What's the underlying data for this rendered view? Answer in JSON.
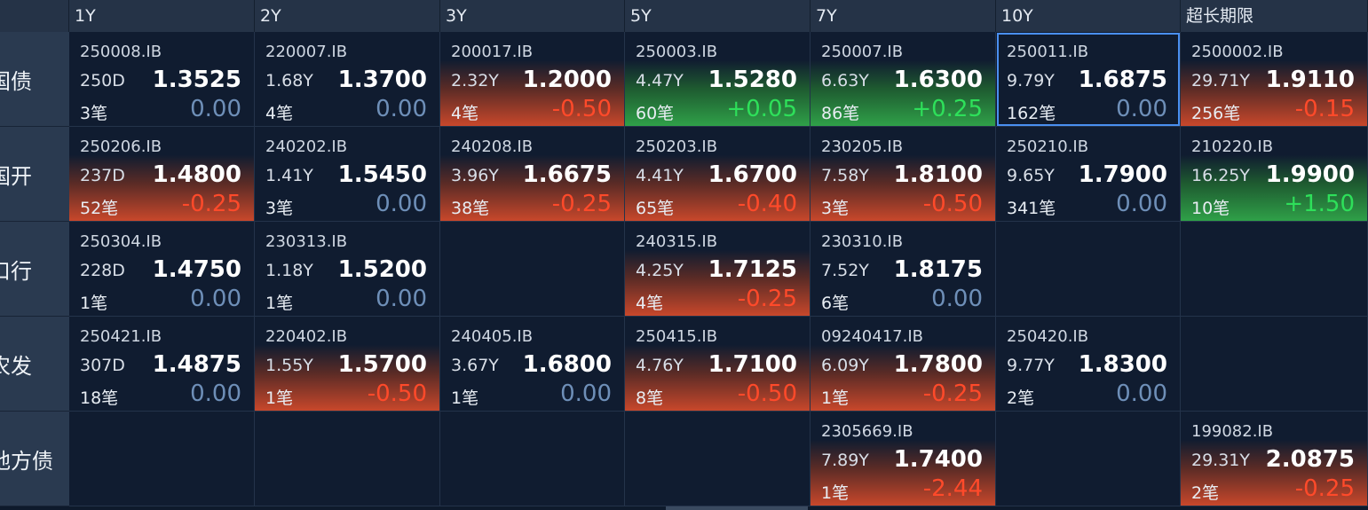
{
  "columns": [
    "1Y",
    "2Y",
    "3Y",
    "5Y",
    "7Y",
    "10Y",
    "超长期限"
  ],
  "rows": [
    {
      "label": "国债",
      "cells": [
        {
          "code": "250008.IB",
          "term": "250D",
          "yield": "1.3525",
          "count": "3笔",
          "change": "0.00",
          "trend": "flat"
        },
        {
          "code": "220007.IB",
          "term": "1.68Y",
          "yield": "1.3700",
          "count": "4笔",
          "change": "0.00",
          "trend": "flat"
        },
        {
          "code": "200017.IB",
          "term": "2.32Y",
          "yield": "1.2000",
          "count": "4笔",
          "change": "-0.50",
          "trend": "down"
        },
        {
          "code": "250003.IB",
          "term": "4.47Y",
          "yield": "1.5280",
          "count": "60笔",
          "change": "+0.05",
          "trend": "up"
        },
        {
          "code": "250007.IB",
          "term": "6.63Y",
          "yield": "1.6300",
          "count": "86笔",
          "change": "+0.25",
          "trend": "up"
        },
        {
          "code": "250011.IB",
          "term": "9.79Y",
          "yield": "1.6875",
          "count": "162笔",
          "change": "0.00",
          "trend": "flat",
          "selected": true
        },
        {
          "code": "2500002.IB",
          "term": "29.71Y",
          "yield": "1.9110",
          "count": "256笔",
          "change": "-0.15",
          "trend": "down"
        }
      ]
    },
    {
      "label": "国开",
      "cells": [
        {
          "code": "250206.IB",
          "term": "237D",
          "yield": "1.4800",
          "count": "52笔",
          "change": "-0.25",
          "trend": "down"
        },
        {
          "code": "240202.IB",
          "term": "1.41Y",
          "yield": "1.5450",
          "count": "3笔",
          "change": "0.00",
          "trend": "flat"
        },
        {
          "code": "240208.IB",
          "term": "3.96Y",
          "yield": "1.6675",
          "count": "38笔",
          "change": "-0.25",
          "trend": "down"
        },
        {
          "code": "250203.IB",
          "term": "4.41Y",
          "yield": "1.6700",
          "count": "65笔",
          "change": "-0.40",
          "trend": "down"
        },
        {
          "code": "230205.IB",
          "term": "7.58Y",
          "yield": "1.8100",
          "count": "3笔",
          "change": "-0.50",
          "trend": "down"
        },
        {
          "code": "250210.IB",
          "term": "9.65Y",
          "yield": "1.7900",
          "count": "341笔",
          "change": "0.00",
          "trend": "flat"
        },
        {
          "code": "210220.IB",
          "term": "16.25Y",
          "yield": "1.9900",
          "count": "10笔",
          "change": "+1.50",
          "trend": "up"
        }
      ]
    },
    {
      "label": "口行",
      "cells": [
        {
          "code": "250304.IB",
          "term": "228D",
          "yield": "1.4750",
          "count": "1笔",
          "change": "0.00",
          "trend": "flat"
        },
        {
          "code": "230313.IB",
          "term": "1.18Y",
          "yield": "1.5200",
          "count": "1笔",
          "change": "0.00",
          "trend": "flat"
        },
        null,
        {
          "code": "240315.IB",
          "term": "4.25Y",
          "yield": "1.7125",
          "count": "4笔",
          "change": "-0.25",
          "trend": "down"
        },
        {
          "code": "230310.IB",
          "term": "7.52Y",
          "yield": "1.8175",
          "count": "6笔",
          "change": "0.00",
          "trend": "flat"
        },
        null,
        null
      ]
    },
    {
      "label": "农发",
      "cells": [
        {
          "code": "250421.IB",
          "term": "307D",
          "yield": "1.4875",
          "count": "18笔",
          "change": "0.00",
          "trend": "flat"
        },
        {
          "code": "220402.IB",
          "term": "1.55Y",
          "yield": "1.5700",
          "count": "1笔",
          "change": "-0.50",
          "trend": "down"
        },
        {
          "code": "240405.IB",
          "term": "3.67Y",
          "yield": "1.6800",
          "count": "1笔",
          "change": "0.00",
          "trend": "flat"
        },
        {
          "code": "250415.IB",
          "term": "4.76Y",
          "yield": "1.7100",
          "count": "8笔",
          "change": "-0.50",
          "trend": "down"
        },
        {
          "code": "09240417.IB",
          "term": "6.09Y",
          "yield": "1.7800",
          "count": "1笔",
          "change": "-0.25",
          "trend": "down"
        },
        {
          "code": "250420.IB",
          "term": "9.77Y",
          "yield": "1.8300",
          "count": "2笔",
          "change": "0.00",
          "trend": "flat"
        },
        null
      ]
    },
    {
      "label": "地方债",
      "cells": [
        null,
        null,
        null,
        null,
        {
          "code": "2305669.IB",
          "term": "7.89Y",
          "yield": "1.7400",
          "count": "1笔",
          "change": "-2.44",
          "trend": "down"
        },
        null,
        {
          "code": "199082.IB",
          "term": "29.31Y",
          "yield": "2.0875",
          "count": "2笔",
          "change": "-0.25",
          "trend": "down"
        }
      ]
    }
  ]
}
